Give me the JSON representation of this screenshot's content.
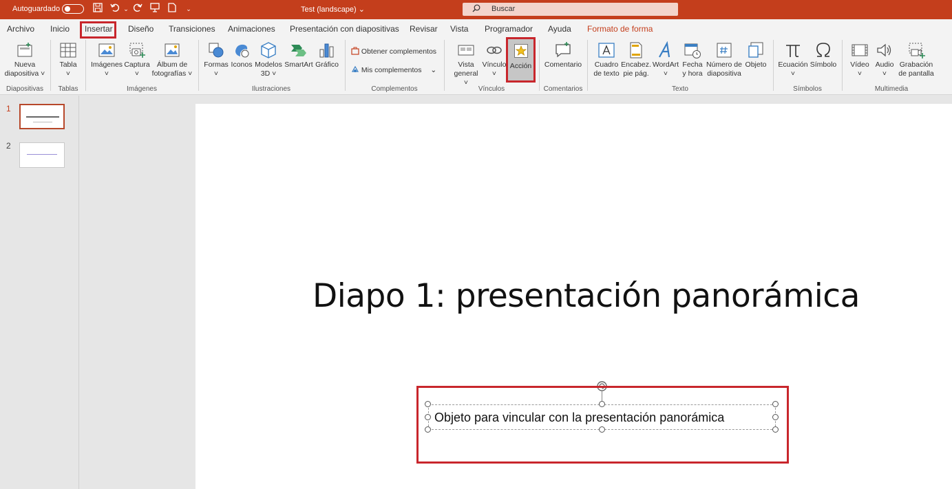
{
  "titlebar": {
    "autosave_label": "Autoguardado",
    "document_title": "Test (landscape)",
    "dropdown_arrow": "⌄",
    "search_placeholder": "Buscar"
  },
  "tabs": [
    {
      "label": "Archivo"
    },
    {
      "label": "Inicio"
    },
    {
      "label": "Insertar"
    },
    {
      "label": "Diseño"
    },
    {
      "label": "Transiciones"
    },
    {
      "label": "Animaciones"
    },
    {
      "label": "Presentación con diapositivas"
    },
    {
      "label": "Revisar"
    },
    {
      "label": "Vista"
    },
    {
      "label": "Programador"
    },
    {
      "label": "Ayuda"
    },
    {
      "label": "Formato de forma"
    }
  ],
  "ribbon": {
    "groups": {
      "diapositivas": "Diapositivas",
      "tablas": "Tablas",
      "imagenes": "Imágenes",
      "ilustraciones": "Ilustraciones",
      "complementos": "Complementos",
      "vinculos": "Vínculos",
      "comentarios": "Comentarios",
      "texto": "Texto",
      "simbolos": "Símbolos",
      "multimedia": "Multimedia"
    },
    "buttons": {
      "nueva_diapositiva": [
        "Nueva",
        "diapositiva ˅"
      ],
      "tabla": [
        "Tabla",
        "˅"
      ],
      "imagenes": [
        "Imágenes",
        "˅"
      ],
      "captura": [
        "Captura",
        "˅"
      ],
      "album": [
        "Álbum de",
        "fotografías ˅"
      ],
      "formas": [
        "Formas",
        "˅"
      ],
      "iconos": "Iconos",
      "modelos3d": [
        "Modelos",
        "3D ˅"
      ],
      "smartart": "SmartArt",
      "grafico": "Gráfico",
      "obtener_complementos": "Obtener complementos",
      "mis_complementos": "Mis complementos",
      "vista_general": [
        "Vista",
        "general ˅"
      ],
      "vinculo": [
        "Vínculo",
        "˅"
      ],
      "accion": "Acción",
      "comentario": "Comentario",
      "cuadro_texto": [
        "Cuadro",
        "de texto"
      ],
      "encabez": [
        "Encabez.",
        "pie pág."
      ],
      "wordart": [
        "WordArt",
        "˅"
      ],
      "fecha_hora": [
        "Fecha",
        "y hora"
      ],
      "numero_diapositiva": [
        "Número de",
        "diapositiva"
      ],
      "objeto": "Objeto",
      "ecuacion": [
        "Ecuación",
        "˅"
      ],
      "simbolo": "Símbolo",
      "video": [
        "Vídeo",
        "˅"
      ],
      "audio": [
        "Audio",
        "˅"
      ],
      "grabacion": [
        "Grabación",
        "de pantalla"
      ]
    }
  },
  "thumbnails": [
    {
      "number": "1"
    },
    {
      "number": "2"
    }
  ],
  "slide": {
    "title": "Diapo 1:  presentación panorámica",
    "textbox": "Objeto para vincular con la presentación panorámica"
  },
  "colors": {
    "brand": "#c43e1c",
    "highlight": "#c8262c"
  }
}
